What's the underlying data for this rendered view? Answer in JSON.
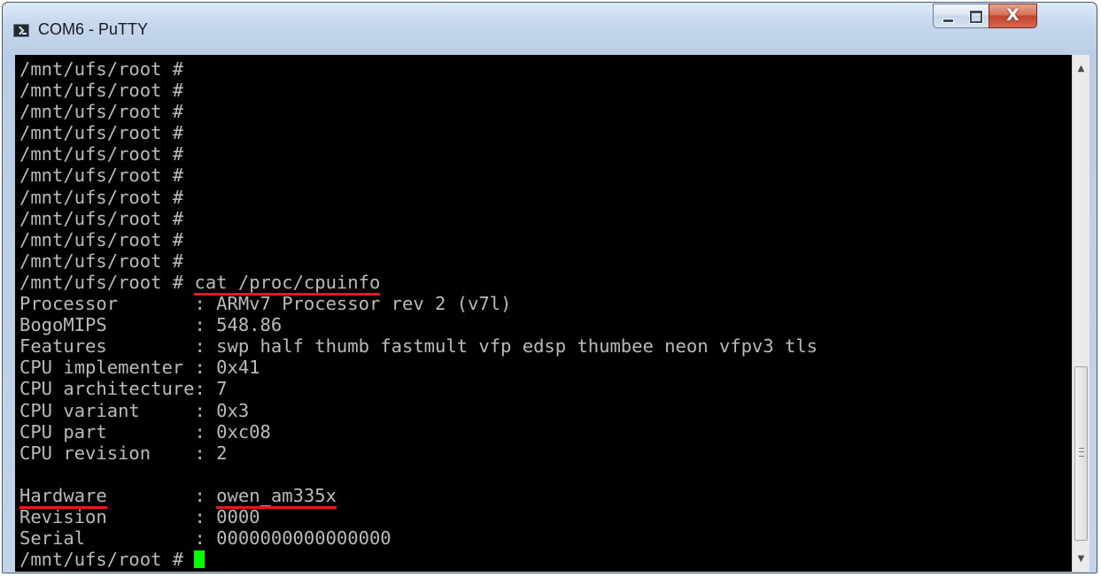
{
  "window": {
    "title": "COM6 - PuTTY",
    "app_icon": "terminal-icon",
    "controls": {
      "minimize": "minimize-icon",
      "maximize": "maximize-icon",
      "close_glyph": "X"
    }
  },
  "terminal": {
    "lines": [
      "/mnt/ufs/root #",
      "/mnt/ufs/root #",
      "/mnt/ufs/root #",
      "/mnt/ufs/root #",
      "/mnt/ufs/root #",
      "/mnt/ufs/root #",
      "/mnt/ufs/root #",
      "/mnt/ufs/root #",
      "/mnt/ufs/root #",
      "/mnt/ufs/root #"
    ],
    "command": {
      "prompt": "/mnt/ufs/root # ",
      "text": "cat /proc/cpuinfo"
    },
    "cpuinfo": [
      "Processor       : ARMv7 Processor rev 2 (v7l)",
      "BogoMIPS        : 548.86",
      "Features        : swp half thumb fastmult vfp edsp thumbee neon vfpv3 tls",
      "CPU implementer : 0x41",
      "CPU architecture: 7",
      "CPU variant     : 0x3",
      "CPU part        : 0xc08",
      "CPU revision    : 2",
      ""
    ],
    "hardware": {
      "label": "Hardware",
      "separator": "        : ",
      "value": "owen_am335x"
    },
    "trailing": [
      "Revision        : 0000",
      "Serial          : 0000000000000000"
    ],
    "final_prompt": "/mnt/ufs/root # ",
    "highlight_color": "#e21c1c",
    "cursor_color": "#00ff00",
    "text_color": "#bbbbbb",
    "background_color": "#000000"
  },
  "scrollbar": {
    "up_arrow": "▲",
    "down_arrow": "▼"
  }
}
